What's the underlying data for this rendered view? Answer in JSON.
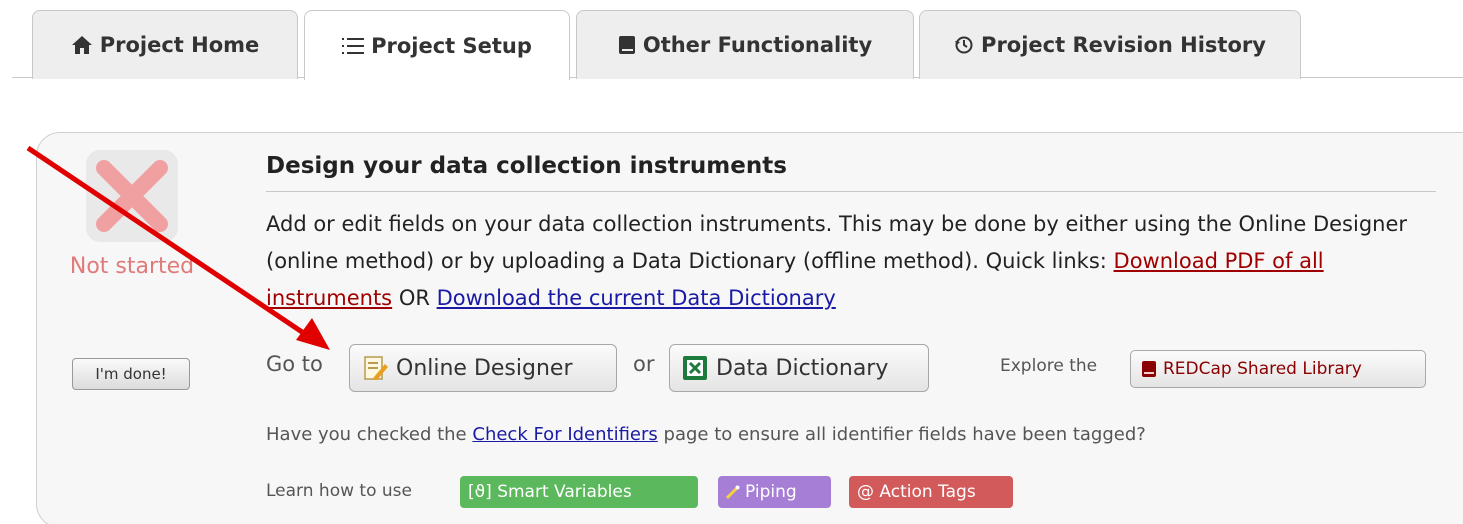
{
  "tabs": [
    {
      "label": "Project Home",
      "icon": "home-icon",
      "active": false
    },
    {
      "label": "Project Setup",
      "icon": "list-icon",
      "active": true
    },
    {
      "label": "Other Functionality",
      "icon": "book-icon",
      "active": false
    },
    {
      "label": "Project Revision History",
      "icon": "history-icon",
      "active": false
    }
  ],
  "status": {
    "text": "Not started",
    "icon": "x-mark-icon",
    "color": "#e07a7a",
    "done_label": "I'm done!"
  },
  "section": {
    "title": "Design your data collection instruments",
    "desc_text": "Add or edit fields on your data collection instruments. This may be done by either using the Online Designer (online method) or by uploading a Data Dictionary (offline method). Quick links:",
    "link_pdf": "Download PDF of all instruments",
    "or_word": "OR",
    "link_dictionary": "Download the current Data Dictionary",
    "goto_label": "Go to",
    "online_designer_label": "Online Designer",
    "or_label": "or",
    "data_dictionary_label": "Data Dictionary",
    "explore_label": "Explore the",
    "shared_library_label": "REDCap Shared Library",
    "check_prefix": "Have you checked the",
    "check_link": "Check For Identifiers",
    "check_suffix": "page to ensure all identifier fields have been tagged?",
    "learn_label": "Learn how to use",
    "smart_variables_label": "[ϑ] Smart Variables",
    "piping_label": "Piping",
    "action_tags_label": "@ Action Tags"
  },
  "colors": {
    "smart_variables": "#5cb85c",
    "piping": "#a67ed6",
    "action_tags": "#d35a5a",
    "annotation_arrow": "#e00000"
  }
}
